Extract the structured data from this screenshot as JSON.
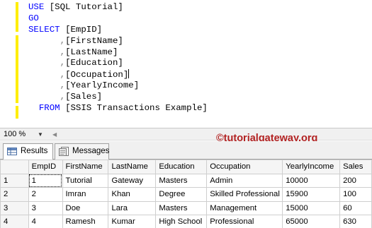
{
  "editor": {
    "lines": [
      [
        {
          "c": "kw",
          "t": "USE "
        },
        {
          "c": "txt",
          "t": "[SQL Tutorial]"
        }
      ],
      [
        {
          "c": "kw",
          "t": "GO"
        }
      ],
      [
        {
          "c": "kw",
          "t": "SELECT "
        },
        {
          "c": "txt",
          "t": "[EmpID]"
        }
      ],
      [
        {
          "c": "gray",
          "t": "      ,"
        },
        {
          "c": "txt",
          "t": "[FirstName]"
        }
      ],
      [
        {
          "c": "gray",
          "t": "      ,"
        },
        {
          "c": "txt",
          "t": "[LastName]"
        }
      ],
      [
        {
          "c": "gray",
          "t": "      ,"
        },
        {
          "c": "txt",
          "t": "[Education]"
        }
      ],
      [
        {
          "c": "gray",
          "t": "      ,"
        },
        {
          "c": "txt",
          "t": "[Occupation]"
        }
      ],
      [
        {
          "c": "gray",
          "t": "      ,"
        },
        {
          "c": "txt",
          "t": "[YearlyIncome]"
        }
      ],
      [
        {
          "c": "gray",
          "t": "      ,"
        },
        {
          "c": "txt",
          "t": "[Sales]"
        }
      ],
      [
        {
          "c": "kw",
          "t": "  FROM "
        },
        {
          "c": "txt",
          "t": "[SSIS Transactions Example]"
        }
      ]
    ]
  },
  "zoom": {
    "value": "100 %"
  },
  "watermark": "©tutorialgateway.org",
  "tabs": {
    "results": "Results",
    "messages": "Messages"
  },
  "grid": {
    "columns": [
      "EmpID",
      "FirstName",
      "LastName",
      "Education",
      "Occupation",
      "YearlyIncome",
      "Sales"
    ],
    "rows": [
      [
        "1",
        "1",
        "Tutorial",
        "Gateway",
        "Masters",
        "Admin",
        "10000",
        "200"
      ],
      [
        "2",
        "2",
        "Imran",
        "Khan",
        "Degree",
        "Skilled Professional",
        "15900",
        "100"
      ],
      [
        "3",
        "3",
        "Doe",
        "Lara",
        "Masters",
        "Management",
        "15000",
        "60"
      ],
      [
        "4",
        "4",
        "Ramesh",
        "Kumar",
        "High School",
        "Professional",
        "65000",
        "630"
      ]
    ]
  }
}
